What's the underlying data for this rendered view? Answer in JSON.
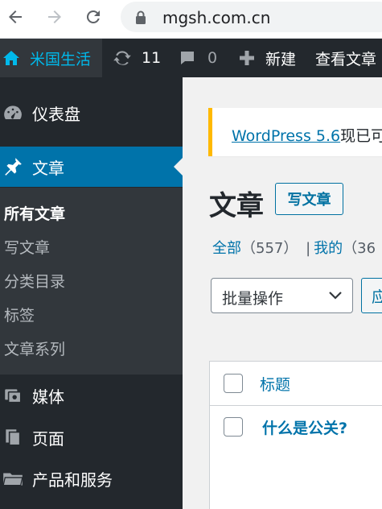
{
  "browser": {
    "url": "mgsh.com.cn",
    "back_icon": "arrow-left-icon",
    "forward_icon": "arrow-right-icon",
    "reload_icon": "reload-icon",
    "lock_icon": "lock-icon"
  },
  "adminbar": {
    "site_name": "米国生活",
    "updates_count": "11",
    "comments_count": "0",
    "new_label": "新建",
    "view_posts_label": "查看文章"
  },
  "sidebar": {
    "items": [
      {
        "label": "仪表盘",
        "icon": "dashboard-icon"
      },
      {
        "label": "文章",
        "icon": "pin-icon"
      },
      {
        "label": "媒体",
        "icon": "media-icon"
      },
      {
        "label": "页面",
        "icon": "page-icon"
      },
      {
        "label": "产品和服务",
        "icon": "folder-icon"
      }
    ],
    "submenu": [
      "所有文章",
      "写文章",
      "分类目录",
      "标签",
      "文章系列"
    ]
  },
  "main": {
    "notice_link": "WordPress 5.6",
    "notice_rest": "现已可",
    "page_title": "文章",
    "add_new": "写文章",
    "filter_all": "全部",
    "filter_all_count": "（557）",
    "filter_sep": "|",
    "filter_mine": "我的",
    "filter_mine_count": "（36",
    "bulk_action": "批量操作",
    "apply": "应",
    "table_header_title": "标题",
    "row_title": "什么是公关?"
  },
  "colors": {
    "admin_bar": "#23282d",
    "sidebar_current": "#0073aa",
    "link": "#0073aa",
    "notice_border": "#ffb900"
  }
}
